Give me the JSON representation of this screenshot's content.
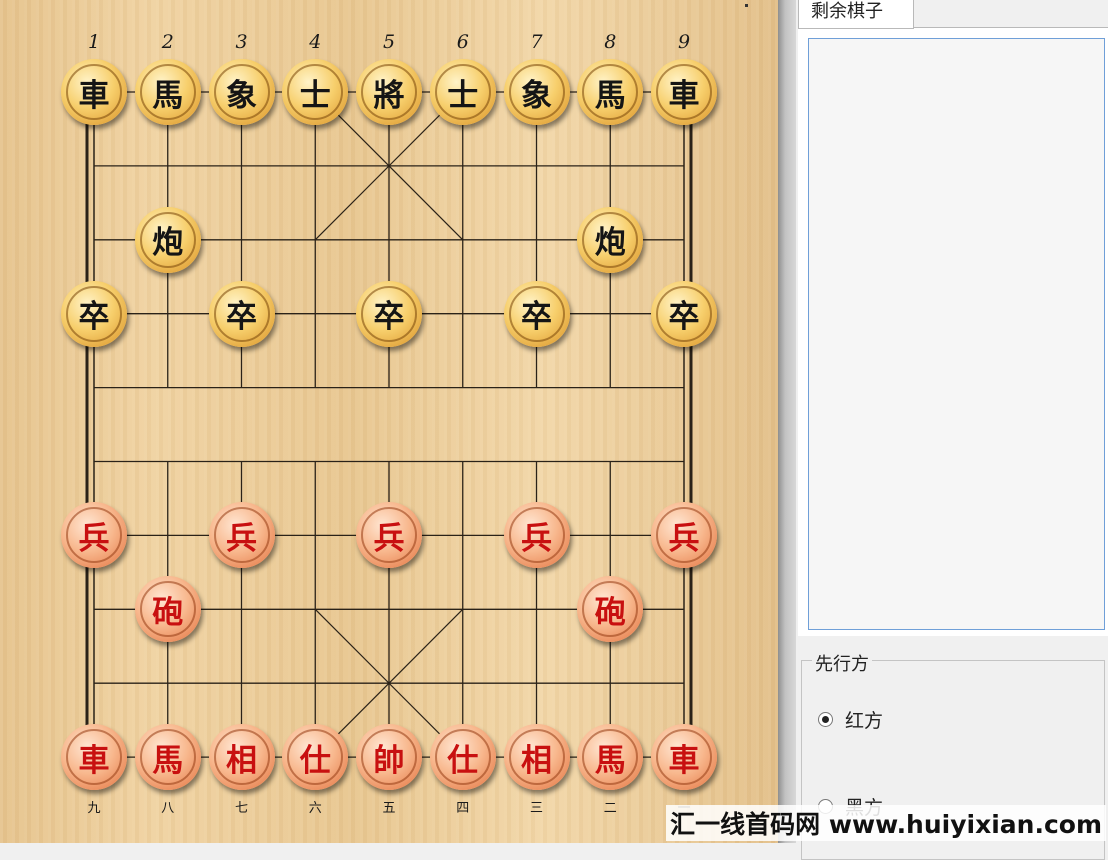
{
  "board": {
    "files_top": [
      "1",
      "2",
      "3",
      "4",
      "5",
      "6",
      "7",
      "8",
      "9"
    ],
    "files_bottom": [
      "九",
      "八",
      "七",
      "六",
      "五",
      "四",
      "三",
      "二",
      "一"
    ],
    "pieces": [
      {
        "text": "車",
        "side": "black",
        "col": 0,
        "row": 0
      },
      {
        "text": "馬",
        "side": "black",
        "col": 1,
        "row": 0
      },
      {
        "text": "象",
        "side": "black",
        "col": 2,
        "row": 0
      },
      {
        "text": "士",
        "side": "black",
        "col": 3,
        "row": 0
      },
      {
        "text": "將",
        "side": "black",
        "col": 4,
        "row": 0
      },
      {
        "text": "士",
        "side": "black",
        "col": 5,
        "row": 0
      },
      {
        "text": "象",
        "side": "black",
        "col": 6,
        "row": 0
      },
      {
        "text": "馬",
        "side": "black",
        "col": 7,
        "row": 0
      },
      {
        "text": "車",
        "side": "black",
        "col": 8,
        "row": 0
      },
      {
        "text": "炮",
        "side": "black",
        "col": 1,
        "row": 2
      },
      {
        "text": "炮",
        "side": "black",
        "col": 7,
        "row": 2
      },
      {
        "text": "卒",
        "side": "black",
        "col": 0,
        "row": 3
      },
      {
        "text": "卒",
        "side": "black",
        "col": 2,
        "row": 3
      },
      {
        "text": "卒",
        "side": "black",
        "col": 4,
        "row": 3
      },
      {
        "text": "卒",
        "side": "black",
        "col": 6,
        "row": 3
      },
      {
        "text": "卒",
        "side": "black",
        "col": 8,
        "row": 3
      },
      {
        "text": "兵",
        "side": "red",
        "col": 0,
        "row": 6
      },
      {
        "text": "兵",
        "side": "red",
        "col": 2,
        "row": 6
      },
      {
        "text": "兵",
        "side": "red",
        "col": 4,
        "row": 6
      },
      {
        "text": "兵",
        "side": "red",
        "col": 6,
        "row": 6
      },
      {
        "text": "兵",
        "side": "red",
        "col": 8,
        "row": 6
      },
      {
        "text": "砲",
        "side": "red",
        "col": 1,
        "row": 7
      },
      {
        "text": "砲",
        "side": "red",
        "col": 7,
        "row": 7
      },
      {
        "text": "車",
        "side": "red",
        "col": 0,
        "row": 9
      },
      {
        "text": "馬",
        "side": "red",
        "col": 1,
        "row": 9
      },
      {
        "text": "相",
        "side": "red",
        "col": 2,
        "row": 9
      },
      {
        "text": "仕",
        "side": "red",
        "col": 3,
        "row": 9
      },
      {
        "text": "帥",
        "side": "red",
        "col": 4,
        "row": 9
      },
      {
        "text": "仕",
        "side": "red",
        "col": 5,
        "row": 9
      },
      {
        "text": "相",
        "side": "red",
        "col": 6,
        "row": 9
      },
      {
        "text": "馬",
        "side": "red",
        "col": 7,
        "row": 9
      },
      {
        "text": "車",
        "side": "red",
        "col": 8,
        "row": 9
      }
    ]
  },
  "side_panel": {
    "tab_label": "剩余棋子",
    "first_mover": {
      "title": "先行方",
      "options": [
        {
          "label": "红方",
          "selected": true
        },
        {
          "label": "黑方",
          "selected": false
        }
      ]
    }
  },
  "watermark": "汇一线首码网 www.huiyixian.com"
}
